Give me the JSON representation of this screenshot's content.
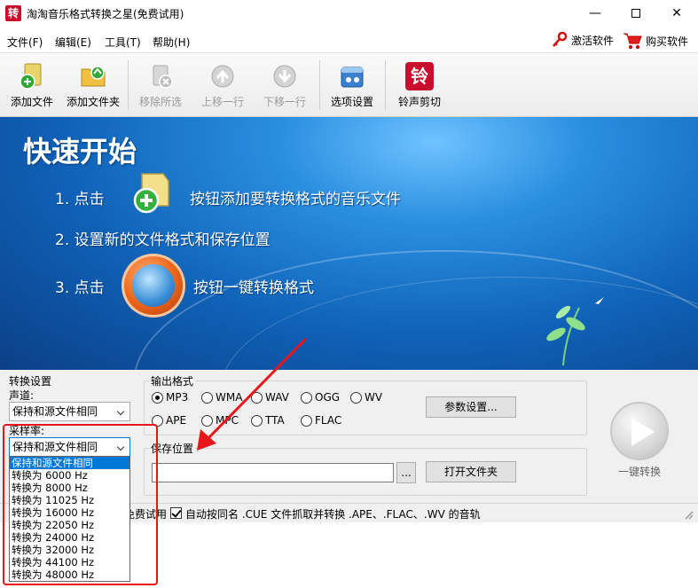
{
  "window": {
    "app_icon_glyph": "转",
    "title": "淘淘音乐格式转换之星(免费试用)",
    "min_glyph": "—",
    "close_glyph": "✕"
  },
  "menu": {
    "items": [
      "文件(F)",
      "编辑(E)",
      "工具(T)",
      "帮助(H)"
    ],
    "activate": "激活软件",
    "buy": "购买软件"
  },
  "toolbar": {
    "add_file": "添加文件",
    "add_folder": "添加文件夹",
    "remove": "移除所选",
    "move_up": "上移一行",
    "move_down": "下移一行",
    "options": "选项设置",
    "ringtone": "铃声剪切",
    "ringtone_glyph": "铃"
  },
  "banner": {
    "title": "快速开始",
    "step1_num": "1. 点击",
    "step1_text": "按钮添加要转换格式的音乐文件",
    "step2": "2. 设置新的文件格式和保存位置",
    "step3_num": "3. 点击",
    "step3_text": "按钮一键转换格式"
  },
  "convert_settings": {
    "title": "转换设置",
    "channel_label": "声道:",
    "channel_value": "保持和源文件相同",
    "samplerate_label": "采样率:",
    "samplerate_value": "保持和源文件相同",
    "samplerate_options": [
      "保持和源文件相同",
      "转换为 6000 Hz",
      "转换为 8000 Hz",
      "转换为 11025 Hz",
      "转换为 16000 Hz",
      "转换为 22050 Hz",
      "转换为 24000 Hz",
      "转换为 32000 Hz",
      "转换为 44100 Hz",
      "转换为 48000 Hz"
    ]
  },
  "output_format": {
    "title": "输出格式",
    "formats_row1": [
      "MP3",
      "WMA",
      "WAV",
      "OGG",
      "WV"
    ],
    "formats_row2": [
      "APE",
      "MPC",
      "TTA",
      "FLAC"
    ],
    "selected": "MP3",
    "params_button": "参数设置..."
  },
  "save_location": {
    "title": "保存位置",
    "path_value": "",
    "browse_button": "...",
    "open_folder_button": "打开文件夹"
  },
  "one_key": {
    "label": "一键转换"
  },
  "statusbar": {
    "left_partial": "免费试用",
    "auto_cue_checked": true,
    "auto_cue_label": "自动按同名 .CUE 文件抓取并转换 .APE、.FLAC、.WV 的音轨"
  },
  "colors": {
    "annotation_red": "#e8161a",
    "selection_blue": "#0078d7",
    "banner_blue": "#0f62b8"
  }
}
